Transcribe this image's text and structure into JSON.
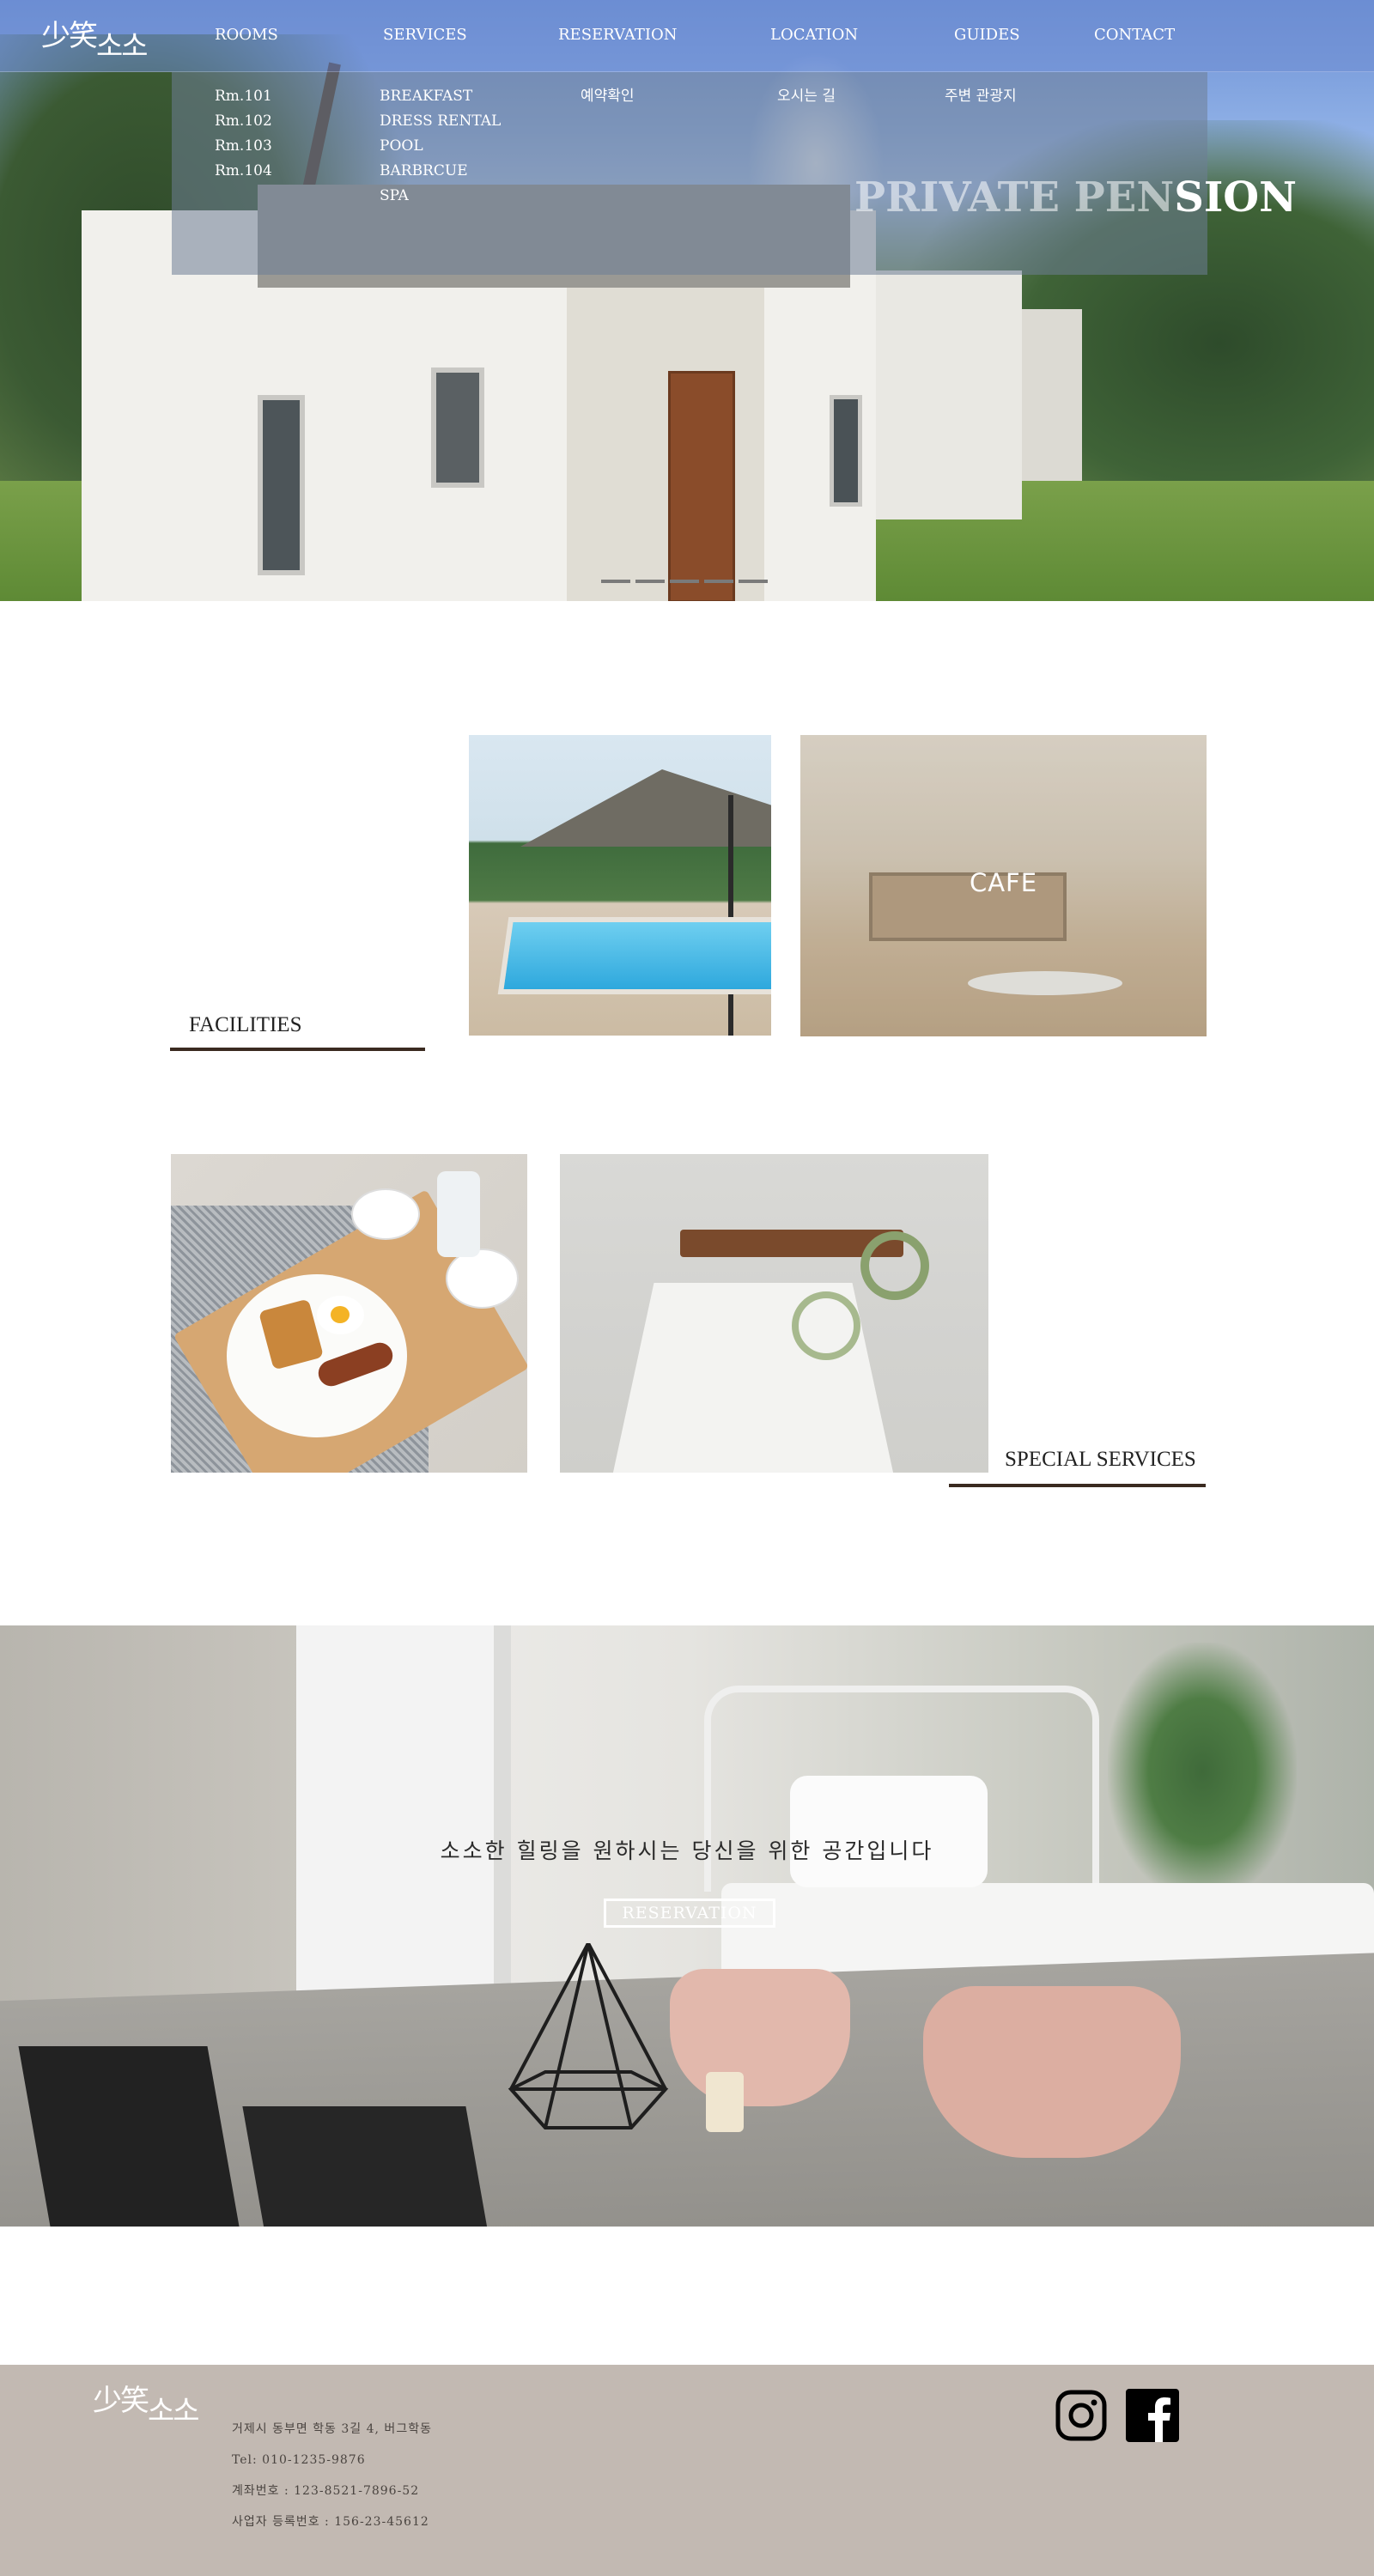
{
  "brand": {
    "hanja": "少笑",
    "hangul": "소소"
  },
  "nav": {
    "items": [
      {
        "label": "ROOMS"
      },
      {
        "label": "SERVICES"
      },
      {
        "label": "RESERVATION"
      },
      {
        "label": "LOCATION"
      },
      {
        "label": "GUIDES"
      },
      {
        "label": "CONTACT"
      }
    ]
  },
  "submenu": {
    "rooms": [
      "Rm.101",
      "Rm.102",
      "Rm.103",
      "Rm.104"
    ],
    "services": [
      "BREAKFAST",
      "DRESS RENTAL",
      "POOL",
      "BARBRCUE",
      "SPA"
    ],
    "reservation": [
      "예약확인"
    ],
    "location": [
      "오시는 길"
    ],
    "guides": [
      "주변 관광지"
    ]
  },
  "hero": {
    "title_dim": "PRIVATE PEN",
    "title_bright": "SION",
    "slide_count": 5
  },
  "facilities": {
    "label": "FACILITIES",
    "cafe_label": "CAFE"
  },
  "special": {
    "label": "SPECIAL SERVICES"
  },
  "banner": {
    "tagline": "소소한 힐링을 원하시는 당신을 위한 공간입니다",
    "button_label": "RESERVATION"
  },
  "footer": {
    "address": "거제시 동부면 학동 3길 4, 버그학동",
    "tel": "Tel: 010-1235-9876",
    "account": "계좌번호 : 123-8521-7896-52",
    "business_no": "사업자 등록번호 : 156-23-45612"
  },
  "social": [
    {
      "icon": "instagram-icon"
    },
    {
      "icon": "facebook-icon"
    }
  ],
  "colors": {
    "footer_bg": "#c2b9b2",
    "section_line": "#3a2a20",
    "header_overlay": "#6e8cd2"
  }
}
